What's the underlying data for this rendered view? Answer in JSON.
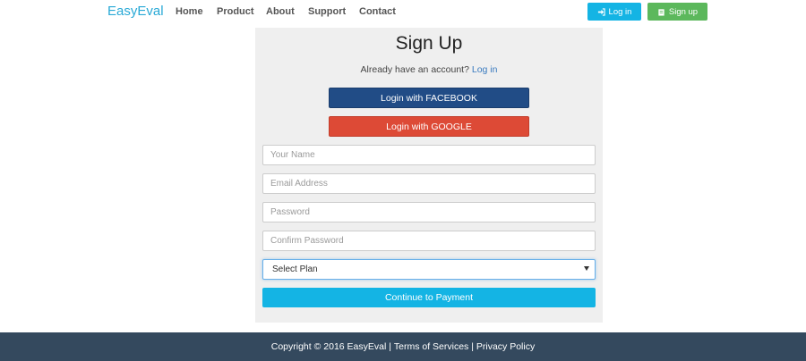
{
  "navbar": {
    "brand": "EasyEval",
    "links": [
      "Home",
      "Product",
      "About",
      "Support",
      "Contact"
    ],
    "login_label": "Log in",
    "signup_label": "Sign up",
    "login_icon": "sign-in-icon",
    "signup_icon": "clipboard-icon"
  },
  "form": {
    "title": "Sign Up",
    "account_prompt": "Already have an account?",
    "login_link": "Log in",
    "facebook_label": "Login with FACEBOOK",
    "google_label": "Login with GOOGLE",
    "name_placeholder": "Your Name",
    "email_placeholder": "Email Address",
    "password_placeholder": "Password",
    "confirm_placeholder": "Confirm Password",
    "plan_selected": "Select Plan",
    "submit_label": "Continue to Payment"
  },
  "footer": {
    "copyright": "Copyright © 2016 EasyEval",
    "separator": " | ",
    "terms": "Terms of Services",
    "privacy": "Privacy Policy"
  },
  "colors": {
    "brand": "#29a9d6",
    "primary": "#14b4e4",
    "success": "#5cb85c",
    "facebook": "#214c86",
    "google": "#dd4a36",
    "footer": "#34495e",
    "panel": "#efefef"
  }
}
